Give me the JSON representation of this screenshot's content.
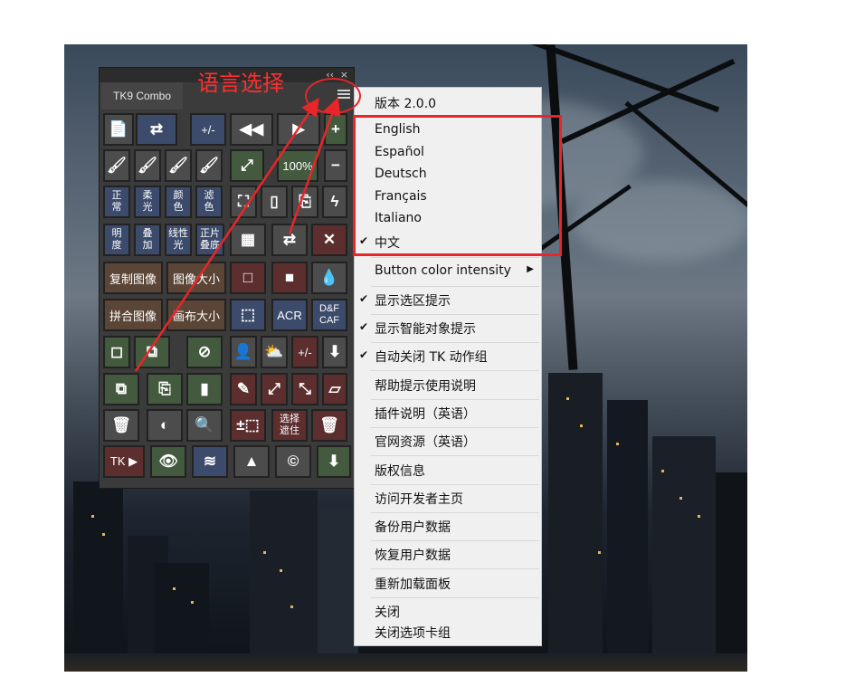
{
  "annotation": {
    "title": "语言选择"
  },
  "panel": {
    "tab_title": "TK9 Combo",
    "collapse_glyph": "‹‹",
    "close_glyph": "×",
    "buttons": [
      [
        "📄",
        "⇄",
        "+/-",
        "◀◀",
        "▶",
        "+"
      ],
      [
        "🖌",
        "🖌",
        "🖌",
        "🖌",
        "⤢",
        "100%",
        "−"
      ],
      [
        "正\n常",
        "柔\n光",
        "颜\n色",
        "滤\n色",
        "⛶",
        "▯",
        "⎘",
        "ϟ"
      ],
      [
        "明\n度",
        "叠\n加",
        "线性\n光",
        "正片\n叠底",
        "▦",
        "⇄",
        "✕"
      ],
      [
        "复制图像",
        "图像大小",
        "□",
        "■",
        "💧"
      ],
      [
        "拼合图像",
        "画布大小",
        "⬚",
        "ACR",
        "D&F\nCAF"
      ],
      [
        "◻",
        "⧉",
        "⊘",
        "👤",
        "⛅",
        "+/-",
        "⬇"
      ],
      [
        "⧉",
        "⎘",
        "▮",
        "✎",
        "⤢",
        "⤡",
        "▱"
      ],
      [
        "🗑",
        "◐",
        "🔍",
        "±⬚",
        "选择\n遮住",
        "🗑"
      ],
      [
        "TK ▶",
        "👁",
        "≋",
        "▲",
        "©",
        "⬇"
      ]
    ]
  },
  "menu": {
    "version": "版本 2.0.0",
    "languages": [
      "English",
      "Español",
      "Deutsch",
      "Français",
      "Italiano",
      "中文"
    ],
    "selected_language": "中文",
    "items": [
      {
        "label": "Button color intensity",
        "checked": false,
        "submenu": true
      },
      {
        "label": "显示选区提示",
        "checked": true
      },
      {
        "label": "显示智能对象提示",
        "checked": true
      },
      {
        "label": "自动关闭 TK 动作组",
        "checked": true
      },
      {
        "label": "帮助提示使用说明",
        "checked": false
      },
      {
        "label": "插件说明（英语）",
        "checked": false
      },
      {
        "label": "官网资源（英语）",
        "checked": false
      },
      {
        "label": "版权信息",
        "checked": false
      },
      {
        "label": "访问开发者主页",
        "checked": false
      },
      {
        "label": "备份用户数据",
        "checked": false
      },
      {
        "label": "恢复用户数据",
        "checked": false
      },
      {
        "label": "重新加载面板",
        "checked": false
      },
      {
        "label": "关闭",
        "checked": false
      },
      {
        "label": "关闭选项卡组",
        "checked": false
      }
    ],
    "check_glyph": "✔",
    "submenu_glyph": "▶"
  },
  "colors": {
    "annotation_red": "#e8262a",
    "panel_bg": "#3b3b3b",
    "menu_bg": "#f0f0f0"
  }
}
